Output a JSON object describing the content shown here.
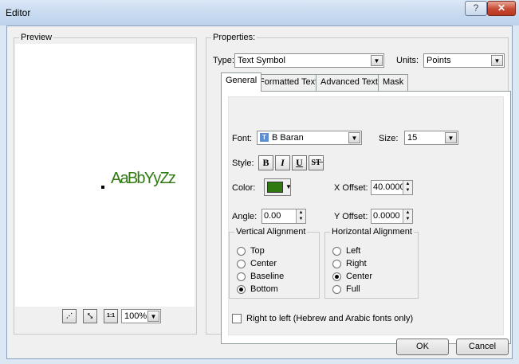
{
  "window": {
    "title": "Editor",
    "help_glyph": "?",
    "close_glyph": "✕"
  },
  "preview": {
    "legend": "Preview",
    "sample_text": "AaBbYyZz",
    "zoom_value": "100%",
    "fit_glyph": "⋰",
    "full_glyph": "⤡",
    "actual_glyph": "1:1"
  },
  "properties": {
    "legend": "Properties:",
    "type_label": "Type:",
    "type_value": "Text Symbol",
    "units_label": "Units:",
    "units_value": "Points"
  },
  "tabs": [
    {
      "label": "General"
    },
    {
      "label": "Formatted Text"
    },
    {
      "label": "Advanced Text"
    },
    {
      "label": "Mask"
    }
  ],
  "general": {
    "font_label": "Font:",
    "font_value": "B Baran",
    "size_label": "Size:",
    "size_value": "15",
    "style_label": "Style:",
    "bold": "B",
    "italic": "I",
    "underline": "U",
    "strike": "S̶T̶",
    "color_label": "Color:",
    "color_value": "#2e7a10",
    "x_offset_label": "X Offset:",
    "x_offset_value": "40.0000",
    "angle_label": "Angle:",
    "angle_value": "0.00",
    "y_offset_label": "Y Offset:",
    "y_offset_value": "0.0000",
    "vertical_alignment": {
      "legend": "Vertical Alignment",
      "options": [
        "Top",
        "Center",
        "Baseline",
        "Bottom"
      ],
      "selected": "Bottom"
    },
    "horizontal_alignment": {
      "legend": "Horizontal Alignment",
      "options": [
        "Left",
        "Right",
        "Center",
        "Full"
      ],
      "selected": "Center"
    },
    "rtl_label": "Right to left (Hebrew and Arabic fonts only)",
    "rtl_checked": false
  },
  "buttons": {
    "ok": "OK",
    "cancel": "Cancel"
  }
}
